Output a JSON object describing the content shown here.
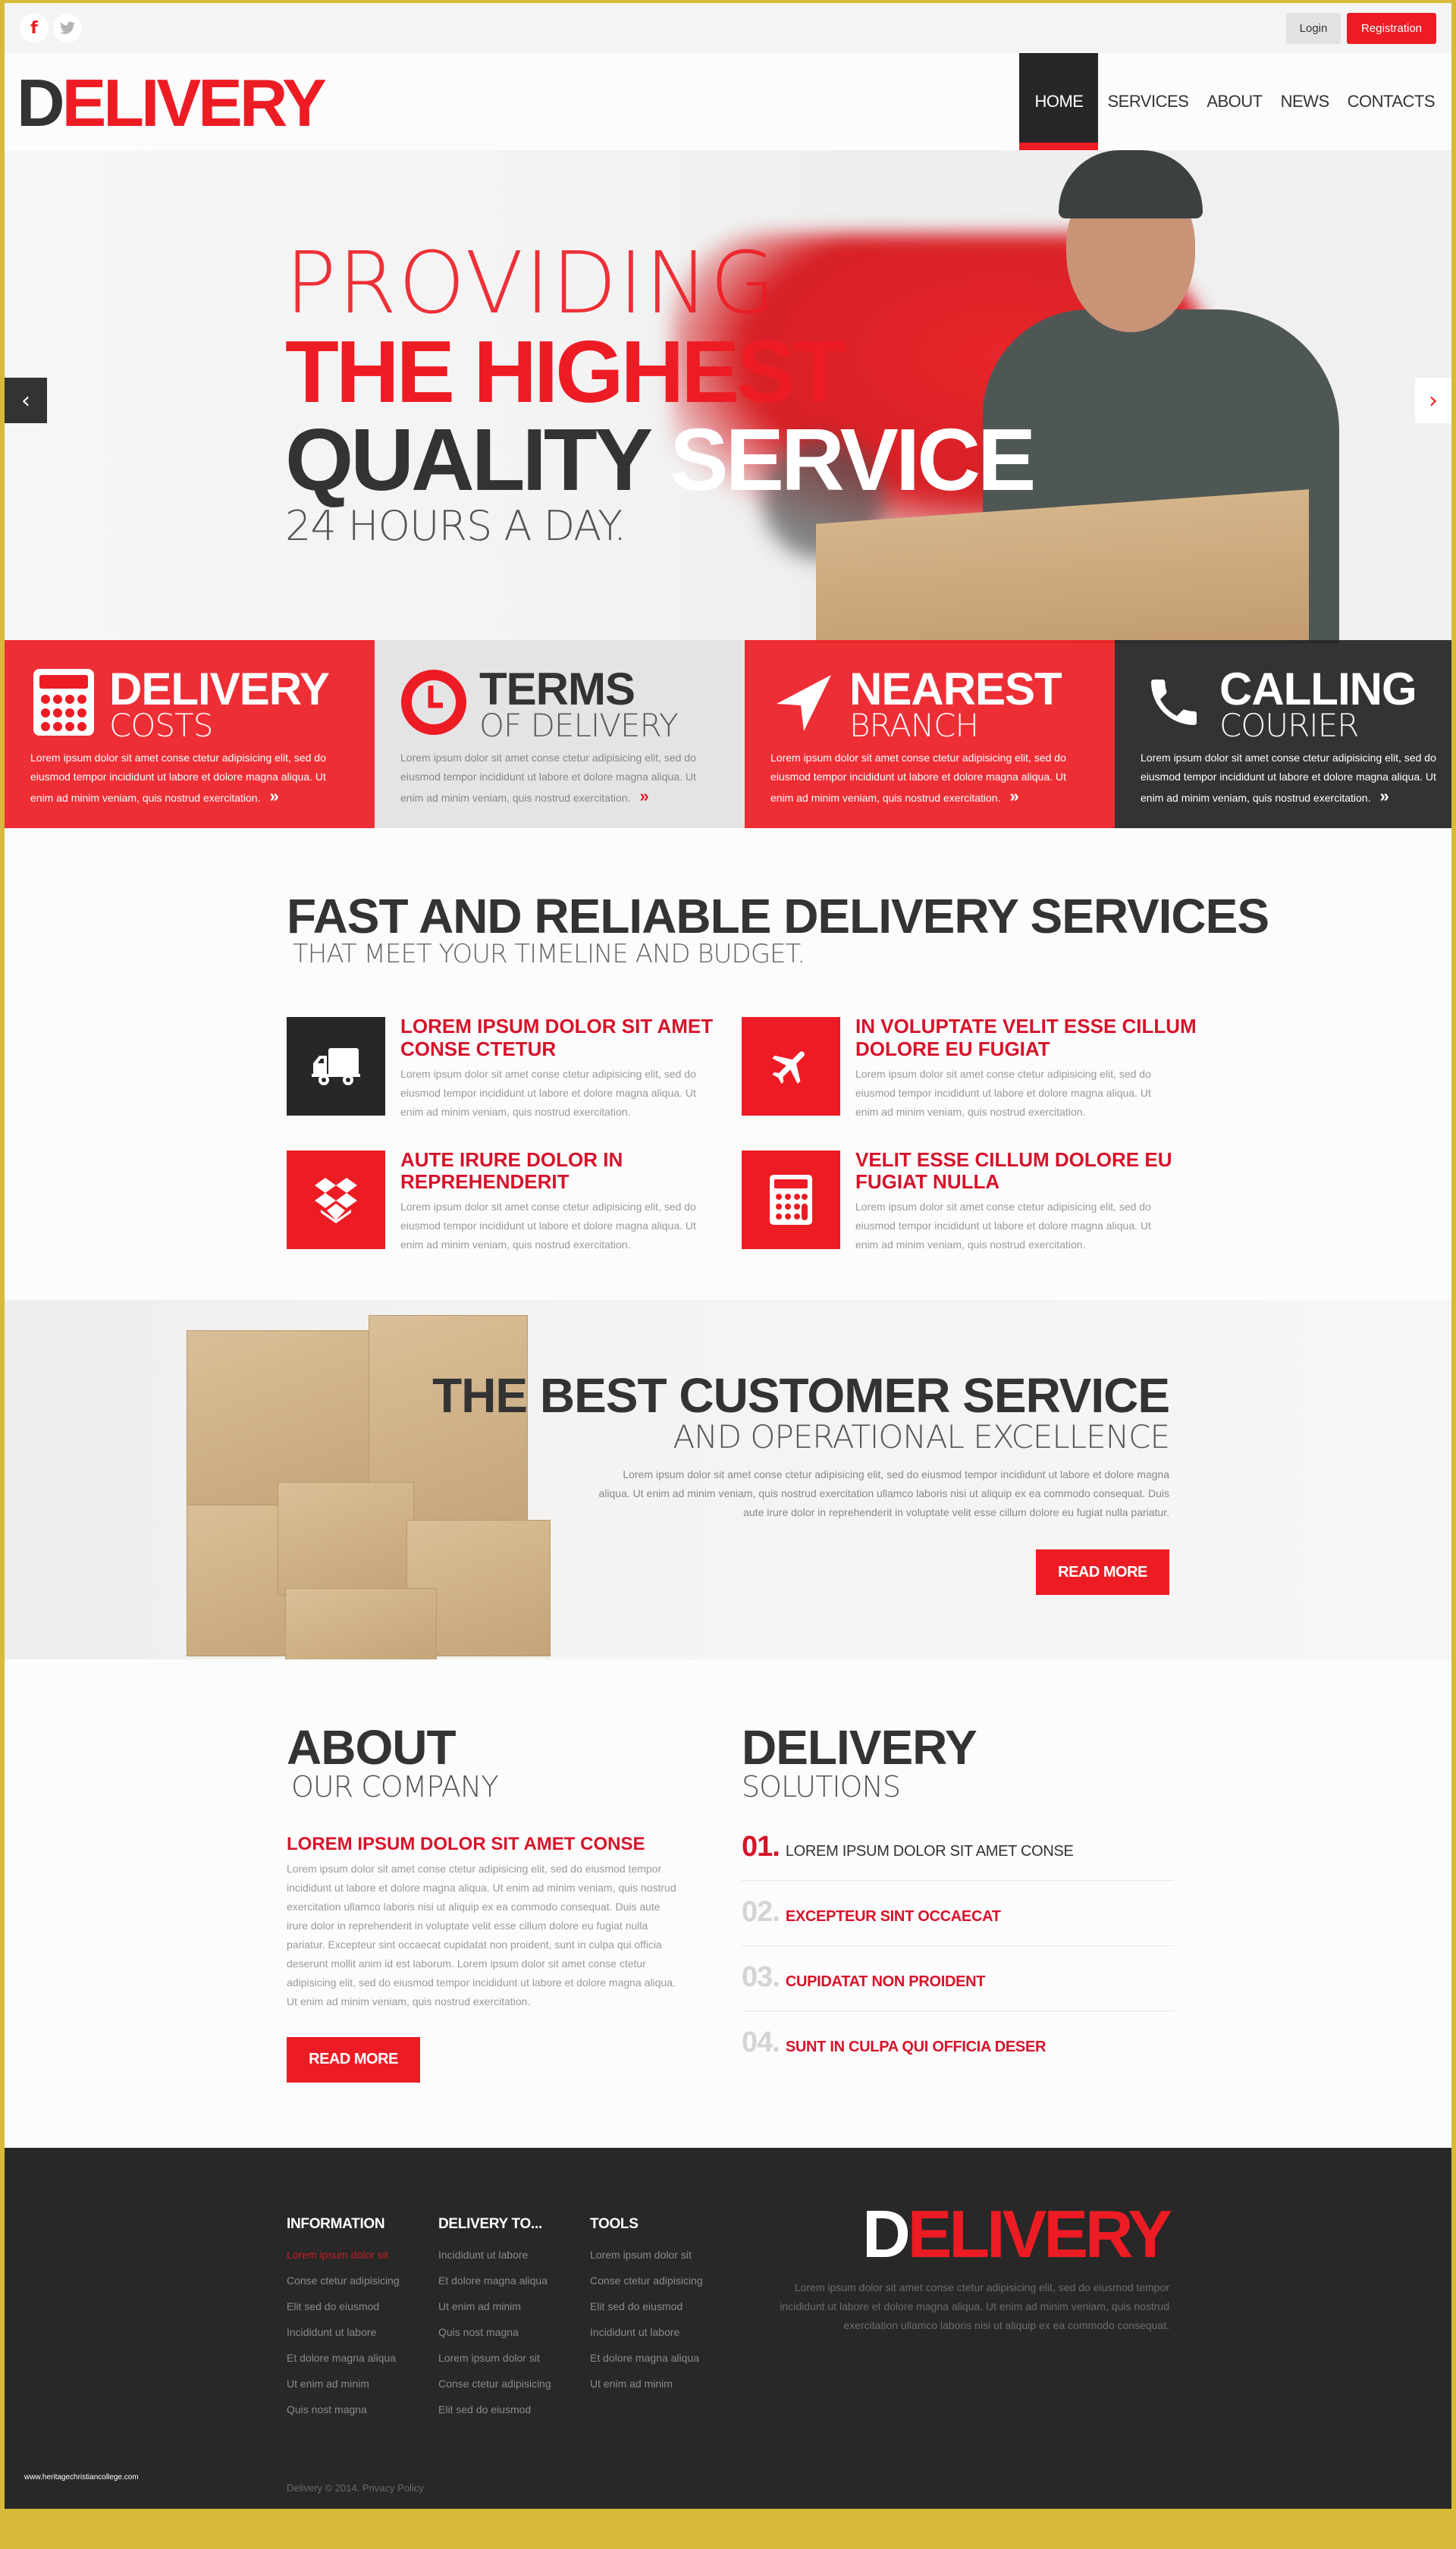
{
  "topbar": {
    "social": [
      {
        "icon": "facebook-icon",
        "glyph": "f"
      },
      {
        "icon": "twitter-icon",
        "glyph": "🐦"
      }
    ],
    "login_label": "Login",
    "registration_label": "Registration"
  },
  "header": {
    "logo_first": "D",
    "logo_rest": "ELIVERY",
    "nav": [
      {
        "label": "HOME",
        "active": true
      },
      {
        "label": "SERVICES"
      },
      {
        "label": "ABOUT"
      },
      {
        "label": "NEWS"
      },
      {
        "label": "CONTACTS"
      }
    ]
  },
  "hero": {
    "line1": "PROVIDING",
    "line2": "THE HIGHEST",
    "line3_a": "QUALITY ",
    "line3_b": "SERVICE",
    "line4": "24 HOURS A DAY.",
    "prev_glyph": "‹",
    "next_glyph": "›"
  },
  "features": [
    {
      "title": "DELIVERY",
      "sub": "COSTS",
      "icon": "calculator-icon",
      "text": "Lorem ipsum dolor sit amet conse ctetur adipisicing elit, sed do eiusmod tempor incididunt ut labore et dolore magna aliqua. Ut enim ad minim veniam, quis nostrud exercitation.",
      "more": "»"
    },
    {
      "title": "TERMS",
      "sub": "OF DELIVERY",
      "icon": "clock-icon",
      "text": "Lorem ipsum dolor sit amet conse ctetur adipisicing elit, sed do eiusmod tempor incididunt ut labore et dolore magna aliqua. Ut enim ad minim veniam, quis nostrud exercitation.",
      "more": "»"
    },
    {
      "title": "NEAREST",
      "sub": "BRANCH",
      "icon": "location-arrow-icon",
      "text": "Lorem ipsum dolor sit amet conse ctetur adipisicing elit, sed do eiusmod tempor incididunt ut labore et dolore magna aliqua. Ut enim ad minim veniam, quis nostrud exercitation.",
      "more": "»"
    },
    {
      "title": "CALLING",
      "sub": "COURIER",
      "icon": "phone-icon",
      "text": "Lorem ipsum dolor sit amet conse ctetur adipisicing elit, sed do eiusmod tempor incididunt ut labore et dolore magna aliqua. Ut enim ad minim veniam, quis nostrud exercitation.",
      "more": "»"
    }
  ],
  "services": {
    "title": "FAST AND RELIABLE DELIVERY SERVICES",
    "subtitle": "THAT MEET YOUR TIMELINE AND BUDGET.",
    "items": [
      {
        "icon": "truck-icon",
        "title": "LOREM IPSUM DOLOR SIT AMET CONSE CTETUR",
        "text": "Lorem ipsum dolor sit amet conse ctetur adipisicing elit, sed do eiusmod tempor incididunt ut labore et dolore magna aliqua. Ut enim ad minim veniam, quis nostrud exercitation."
      },
      {
        "icon": "airplane-icon",
        "title": "IN VOLUPTATE VELIT ESSE CILLUM DOLORE EU FUGIAT",
        "text": "Lorem ipsum dolor sit amet conse ctetur adipisicing elit, sed do eiusmod tempor incididunt ut labore et dolore magna aliqua. Ut enim ad minim veniam, quis nostrud exercitation."
      },
      {
        "icon": "dropbox-icon",
        "title": "AUTE IRURE DOLOR IN REPREHENDERIT",
        "text": "Lorem ipsum dolor sit amet conse ctetur adipisicing elit, sed do eiusmod tempor incididunt ut labore et dolore magna aliqua. Ut enim ad minim veniam, quis nostrud exercitation."
      },
      {
        "icon": "calculator-icon",
        "title": "VELIT ESSE CILLUM DOLORE EU FUGIAT NULLA",
        "text": "Lorem ipsum dolor sit amet conse ctetur adipisicing elit, sed do eiusmod tempor incididunt ut labore et dolore magna aliqua. Ut enim ad minim veniam, quis nostrud exercitation."
      }
    ]
  },
  "customer_service": {
    "title": "THE BEST CUSTOMER SERVICE",
    "subtitle": "AND OPERATIONAL EXCELLENCE",
    "text": "Lorem ipsum dolor sit amet conse ctetur adipisicing elit, sed do eiusmod tempor incididunt ut labore et dolore magna aliqua. Ut enim ad minim veniam, quis nostrud exercitation ullamco laboris nisi ut aliquip ex ea commodo consequat. Duis aute irure dolor in reprehenderit in voluptate velit esse cillum dolore eu fugiat nulla pariatur.",
    "button": "READ MORE"
  },
  "about": {
    "title": "ABOUT",
    "subtitle": "OUR COMPANY",
    "heading": "LOREM IPSUM DOLOR SIT AMET CONSE",
    "text": "Lorem ipsum dolor sit amet conse ctetur adipisicing elit, sed do eiusmod tempor incididunt ut labore et dolore magna aliqua. Ut enim ad minim veniam, quis nostrud exercitation ullamco laboris nisi ut aliquip ex ea commodo consequat. Duis aute irure dolor in reprehenderit in voluptate velit esse cillum dolore eu fugiat nulla pariatur. Excepteur sint occaecat cupidatat non proident, sunt in culpa qui officia deserunt mollit anim id est laborum. Lorem ipsum dolor sit amet conse ctetur adipisicing elit, sed do eiusmod tempor incididunt ut labore et dolore magna aliqua. Ut enim ad minim veniam, quis nostrud exercitation.",
    "button": "READ MORE"
  },
  "solutions": {
    "title": "DELIVERY",
    "subtitle": "SOLUTIONS",
    "items": [
      {
        "num": "01.",
        "label": "LOREM IPSUM DOLOR SIT AMET CONSE",
        "active": true
      },
      {
        "num": "02.",
        "label": "EXCEPTEUR SINT OCCAECAT"
      },
      {
        "num": "03.",
        "label": "CUPIDATAT NON PROIDENT"
      },
      {
        "num": "04.",
        "label": "SUNT IN CULPA QUI OFFICIA DESER"
      }
    ]
  },
  "footer": {
    "columns": [
      {
        "title": "INFORMATION",
        "links": [
          "Lorem ipsum dolor sit",
          "Conse ctetur adipisicing",
          "Elit sed do eiusmod",
          "Incididunt ut labore",
          "Et dolore magna aliqua",
          "Ut enim ad minim",
          "Quis nost magna"
        ]
      },
      {
        "title": "DELIVERY TO...",
        "links": [
          "Incididunt ut labore",
          "Et dolore magna aliqua",
          "Ut enim ad minim",
          "Quis nost magna",
          "Lorem ipsum dolor sit",
          "Conse ctetur adipisicing",
          "Elit sed do eiusmod"
        ]
      },
      {
        "title": "TOOLS",
        "links": [
          "Lorem ipsum dolor sit",
          "Conse ctetur adipisicing",
          "Elit sed do eiusmod",
          "Incididunt ut labore",
          "Et dolore magna aliqua",
          "Ut enim ad minim"
        ]
      }
    ],
    "logo_first": "D",
    "logo_rest": "ELIVERY",
    "text": "Lorem ipsum dolor sit amet conse ctetur adipisicing elit, sed do eiusmod tempor incididunt ut labore et dolore magna aliqua. Ut enim ad minim veniam, quis nostrud exercitation ullamco laboris nisi ut aliquip ex ea commodo consequat.",
    "copyright": "Delivery © 2014.",
    "privacy": "Privacy Policy",
    "watermark": "www.heritagechristiancollege.com"
  },
  "colors": {
    "accent": "#ed1c24",
    "dark": "#272727",
    "heading_red": "#d7132a"
  }
}
